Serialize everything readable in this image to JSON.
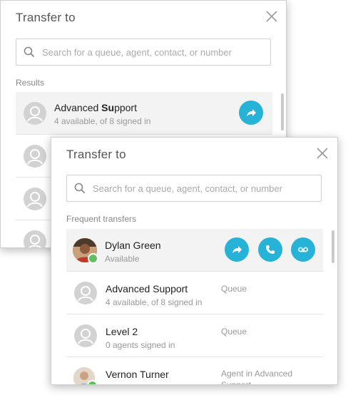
{
  "colors": {
    "accent": "#27b3d8",
    "available": "#5cc05c"
  },
  "back_dialog": {
    "title": "Transfer to",
    "close_icon": "close-icon",
    "search": {
      "placeholder": "Search for a queue, agent, contact, or number",
      "value": ""
    },
    "section_label": "Results",
    "results": [
      {
        "name_prefix": "Advanced ",
        "name_match": "Su",
        "name_suffix": "pport",
        "sub": "4 available, of 8 signed in",
        "action_icon": "transfer-icon"
      }
    ]
  },
  "front_dialog": {
    "title": "Transfer to",
    "close_icon": "close-icon",
    "search": {
      "placeholder": "Search for a queue, agent, contact, or number",
      "value": ""
    },
    "section_label": "Frequent transfers",
    "items": [
      {
        "name": "Dylan Green",
        "sub": "Available",
        "type": "",
        "actions": [
          "transfer-icon",
          "phone-icon",
          "voicemail-icon"
        ]
      },
      {
        "name": "Advanced Support",
        "sub": "4 available, of 8 signed in",
        "type": "Queue"
      },
      {
        "name": "Level 2",
        "sub": "0 agents signed in",
        "type": "Queue"
      },
      {
        "name": "Vernon Turner",
        "sub": "",
        "type": "Agent in Advanced Support"
      }
    ]
  }
}
